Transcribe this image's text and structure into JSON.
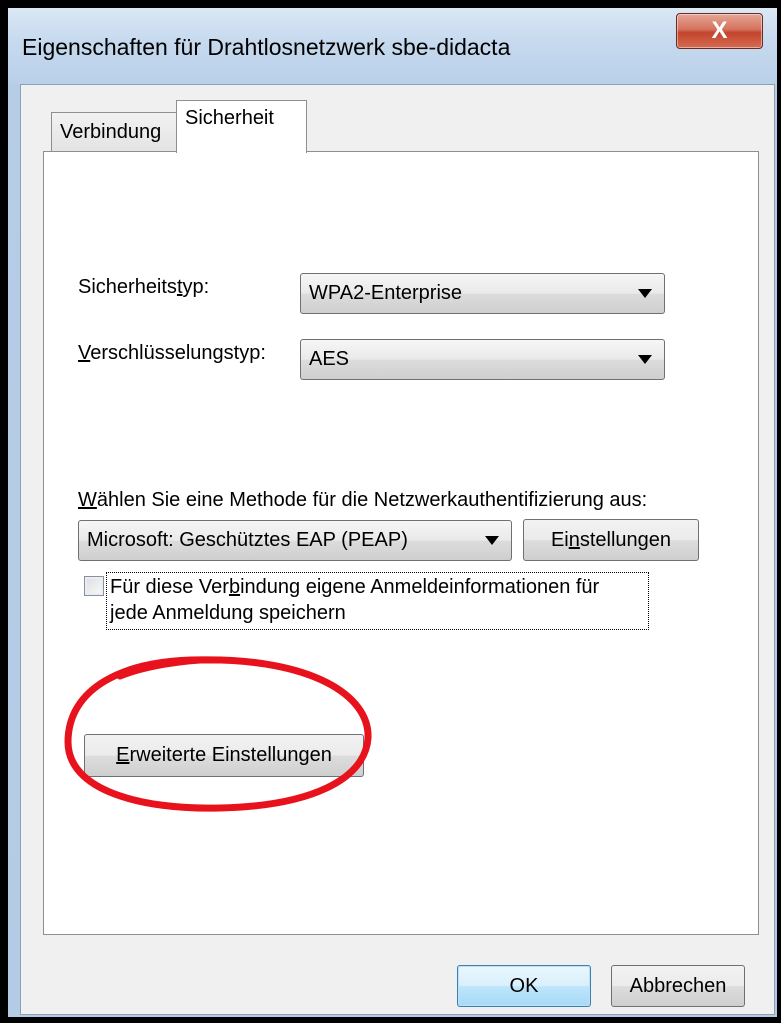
{
  "window": {
    "title": "Eigenschaften für Drahtlosnetzwerk sbe-didacta",
    "close_glyph": "X"
  },
  "tabs": [
    {
      "label": "Verbindung",
      "selected": false
    },
    {
      "label": "Sicherheit",
      "selected": true
    }
  ],
  "security": {
    "security_type_label_pre": "Sicherheits",
    "security_type_label_accel": "t",
    "security_type_label_post": "yp:",
    "security_type_value": "WPA2-Enterprise",
    "encryption_type_label_accel": "V",
    "encryption_type_label_post": "erschlüsselungstyp:",
    "encryption_type_value": "AES",
    "auth_method_label_accel": "W",
    "auth_method_label_post": "ählen Sie eine Methode für die Netzwerkauthentifizierung aus:",
    "auth_method_value": "Microsoft: Geschütztes EAP (PEAP)",
    "settings_button_pre": "Ei",
    "settings_button_accel": "n",
    "settings_button_post": "stellungen",
    "remember_checkbox_line1_pre": "Für diese Ver",
    "remember_checkbox_line1_accel": "b",
    "remember_checkbox_line1_post": "indung eigene Anmeldeinformationen für",
    "remember_checkbox_line2": "jede Anmeldung speichern",
    "remember_checked": false,
    "advanced_button_accel": "E",
    "advanced_button_post": "rweiterte Einstellungen"
  },
  "footer": {
    "ok_label": "OK",
    "cancel_label": "Abbrechen"
  },
  "colors": {
    "annotation": "#e8121c",
    "titlebar": "#c6d9ee",
    "close_button": "#c2452d"
  }
}
